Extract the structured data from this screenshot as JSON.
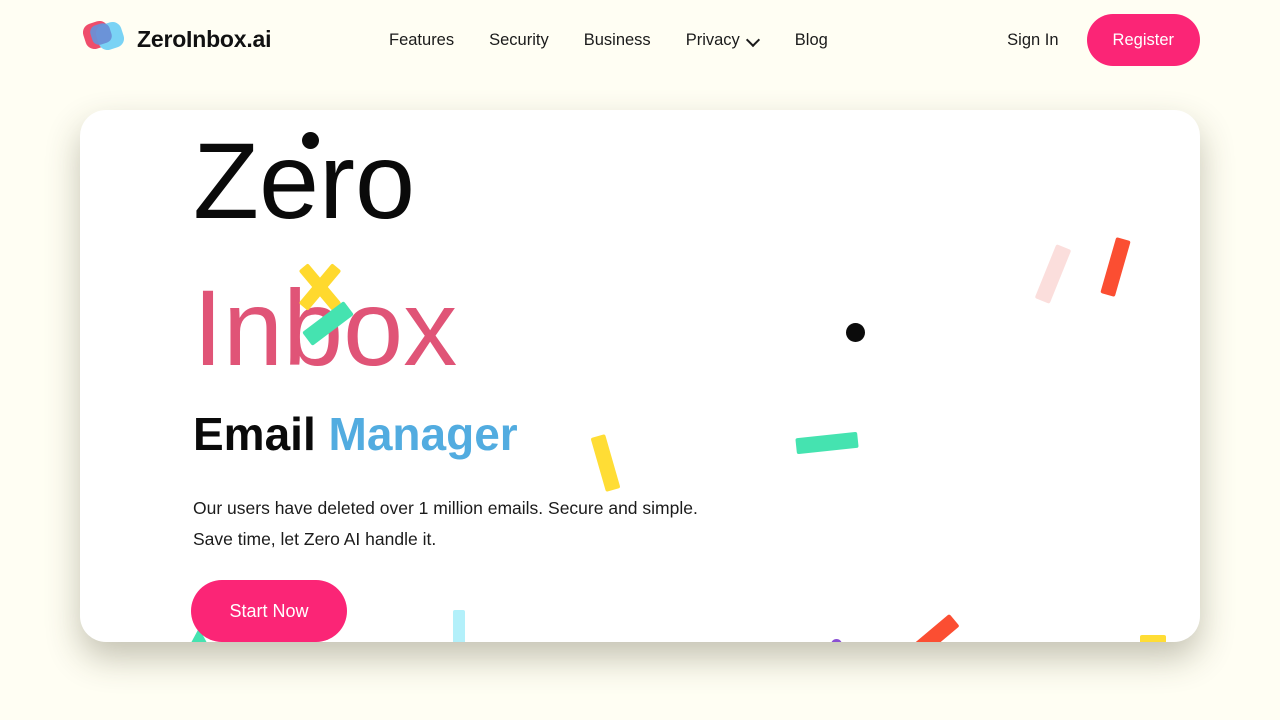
{
  "colors": {
    "page_bg": "#FFFEF3",
    "card_bg": "#FFFFFF",
    "accent_pink": "#FB2576",
    "heading_pink": "#E05477",
    "accent_blue": "#52ACE0",
    "confetti_yellow": "#FFDD35",
    "confetti_green": "#45E3B0",
    "confetti_orange": "#FB4E32",
    "confetti_cyan": "#B3F0FA",
    "confetti_purple": "#8A4FD3",
    "confetti_pale_pink": "#FBDEDC",
    "text_dark": "#0A0A0A"
  },
  "header": {
    "brand": {
      "name": "ZeroInbox.ai",
      "logo_icon": "overlapping-squares-logo-icon"
    },
    "nav": [
      {
        "label": "Features",
        "has_dropdown": false
      },
      {
        "label": "Security",
        "has_dropdown": false
      },
      {
        "label": "Business",
        "has_dropdown": false
      },
      {
        "label": "Privacy",
        "has_dropdown": true,
        "dropdown_icon": "chevron-down-icon"
      },
      {
        "label": "Blog",
        "has_dropdown": false
      }
    ],
    "sign_in_label": "Sign In",
    "register_label": "Register"
  },
  "hero": {
    "headline_line1": "Zero",
    "headline_line2": "Inbox",
    "subhead_prefix": "Email",
    "subhead_accent": "Manager",
    "paragraph": "Our users have deleted over 1 million emails. Secure and simple. Save time, let Zero AI handle it.",
    "cta_label": "Start Now"
  },
  "decorations": [
    {
      "name": "black-dot-over-zero",
      "shape": "dot",
      "color": "#0B0B0B"
    },
    {
      "name": "yellow-cross-confetti",
      "shape": "cross",
      "color": "#FFD92E"
    },
    {
      "name": "green-bar-over-inbox",
      "shape": "bar",
      "color": "#45E3B0"
    },
    {
      "name": "pale-pink-bar",
      "shape": "bar",
      "color": "#FBDEDC"
    },
    {
      "name": "orange-bar-top-right",
      "shape": "bar",
      "color": "#FB4E32"
    },
    {
      "name": "black-dot-center",
      "shape": "dot",
      "color": "#0B0B0B"
    },
    {
      "name": "yellow-bar-center",
      "shape": "bar",
      "color": "#FFDD35"
    },
    {
      "name": "green-bar-center",
      "shape": "bar",
      "color": "#45E3B0"
    },
    {
      "name": "green-triangle-bottom-left",
      "shape": "triangle",
      "color": "#45E3B0"
    },
    {
      "name": "cyan-bar-bottom",
      "shape": "bar",
      "color": "#B3F0FA"
    },
    {
      "name": "purple-dot-bottom",
      "shape": "dot",
      "color": "#8A4FD3"
    },
    {
      "name": "orange-bar-bottom",
      "shape": "bar",
      "color": "#FB4E32"
    },
    {
      "name": "yellow-bar-bottom-right",
      "shape": "bar",
      "color": "#FFDD35"
    }
  ]
}
